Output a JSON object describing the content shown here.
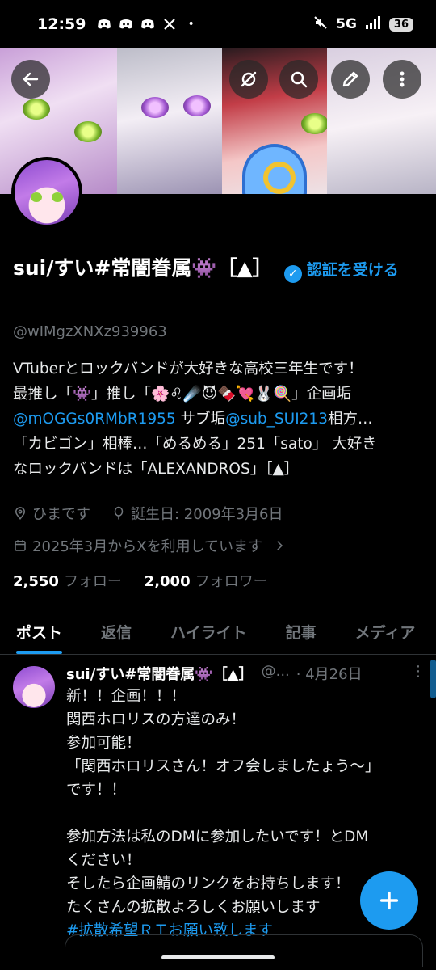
{
  "status_bar": {
    "time": "12:59",
    "network": "5G",
    "battery": "36",
    "notification_icons": [
      "discord-icon",
      "discord-icon",
      "discord-icon",
      "x-icon"
    ]
  },
  "profile": {
    "display_name": "sui/すい#常闇眷属👾［▲］",
    "get_verified_label": "認証を受ける",
    "handle": "@wIMgzXNXz939963",
    "bio_lines": [
      "VTuberとロックバンドが大好きな高校三年生です！",
      "最推し「👾」推し「🌸♌☄️😈🍫💘🐰🍭」企画垢",
      "@mOGGs0RMbR1955",
      " サブ垢",
      "@sub_SUI213",
      "相方…",
      "「カビゴン」相棒…「めるめる」251「sato」 大好き",
      "なロックバンドは「ALEXANDROS」［▲］"
    ],
    "location": "ひまです",
    "birthday": "誕生日: 2009年3月6日",
    "joined": "2025年3月からXを利用しています",
    "following_count": "2,550",
    "following_label": "フォロー",
    "followers_count": "2,000",
    "followers_label": "フォロワー"
  },
  "tabs": [
    "ポスト",
    "返信",
    "ハイライト",
    "記事",
    "メディア"
  ],
  "active_tab": "ポスト",
  "post": {
    "author": "sui/すい#常闇眷属👾［▲］",
    "handle": "@...",
    "date": "· 4月26日",
    "more": "⋮",
    "text": "新！！企画！！！\n関西ホロリスの方達のみ！\n参加可能！\n「関西ホロリスさん！オフ会しましたょう〜」\nです！！\n\n参加方法は私のDMに参加したいです！とDM\nください！\nそしたら企画鯖のリンクをお持ちします！\nたくさんの拡散よろしくお願いします",
    "hashtag": "#拡散希望ＲＴお願い致します"
  },
  "accent_color": "#1d9bf0"
}
